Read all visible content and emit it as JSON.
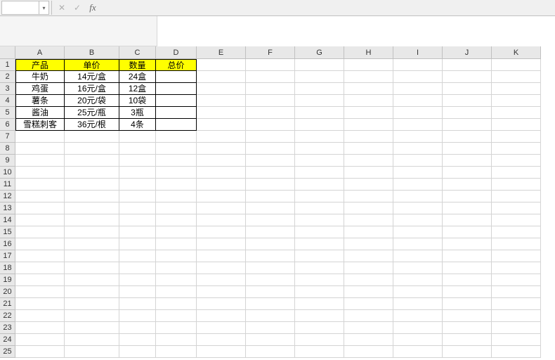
{
  "formula_bar": {
    "name_box_value": "",
    "cancel_icon": "✕",
    "confirm_icon": "✓",
    "fx_label": "fx"
  },
  "columns": [
    "A",
    "B",
    "C",
    "D",
    "E",
    "F",
    "G",
    "H",
    "I",
    "J",
    "K"
  ],
  "table": {
    "headers": {
      "product": "产品",
      "price": "单价",
      "qty": "数量",
      "total": "总价"
    },
    "rows": [
      {
        "product": "牛奶",
        "price": "14元/盒",
        "qty": "24盒",
        "total": ""
      },
      {
        "product": "鸡蛋",
        "price": "16元/盒",
        "qty": "12盒",
        "total": ""
      },
      {
        "product": "薯条",
        "price": "20元/袋",
        "qty": "10袋",
        "total": ""
      },
      {
        "product": "酱油",
        "price": "25元/瓶",
        "qty": "3瓶",
        "total": ""
      },
      {
        "product": "雪糕刺客",
        "price": "36元/根",
        "qty": "4条",
        "total": ""
      }
    ]
  }
}
